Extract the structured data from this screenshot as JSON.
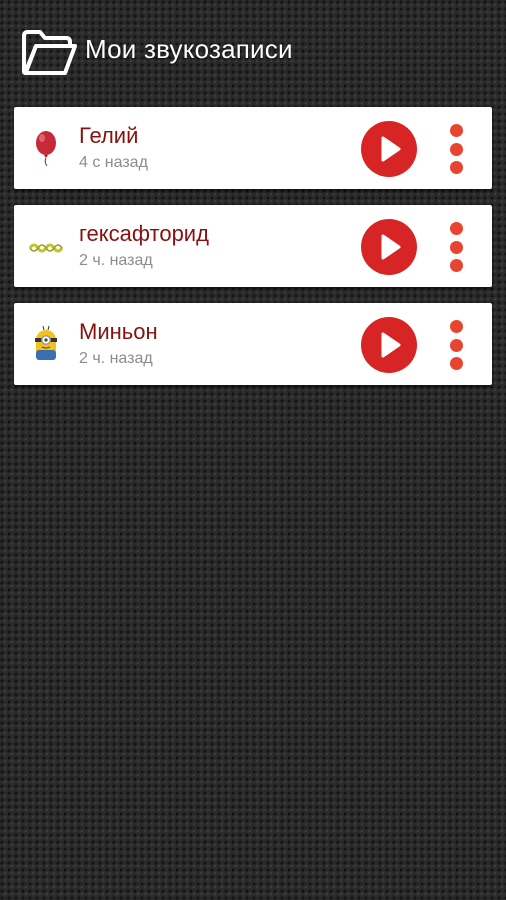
{
  "header": {
    "title": "Мои звукозаписи",
    "icon": "folder-icon"
  },
  "recordings": [
    {
      "name": "Гелий",
      "time": "4 с назад",
      "icon": "balloon-icon"
    },
    {
      "name": "гексафторид",
      "time": "2 ч. назад",
      "icon": "wave-icon"
    },
    {
      "name": "Миньон",
      "time": "2 ч. назад",
      "icon": "minion-icon"
    }
  ],
  "colors": {
    "accent": "#d72525",
    "menu_dots": "#e8442f",
    "name_text": "#8a1010",
    "time_text": "#8c8c8c"
  }
}
